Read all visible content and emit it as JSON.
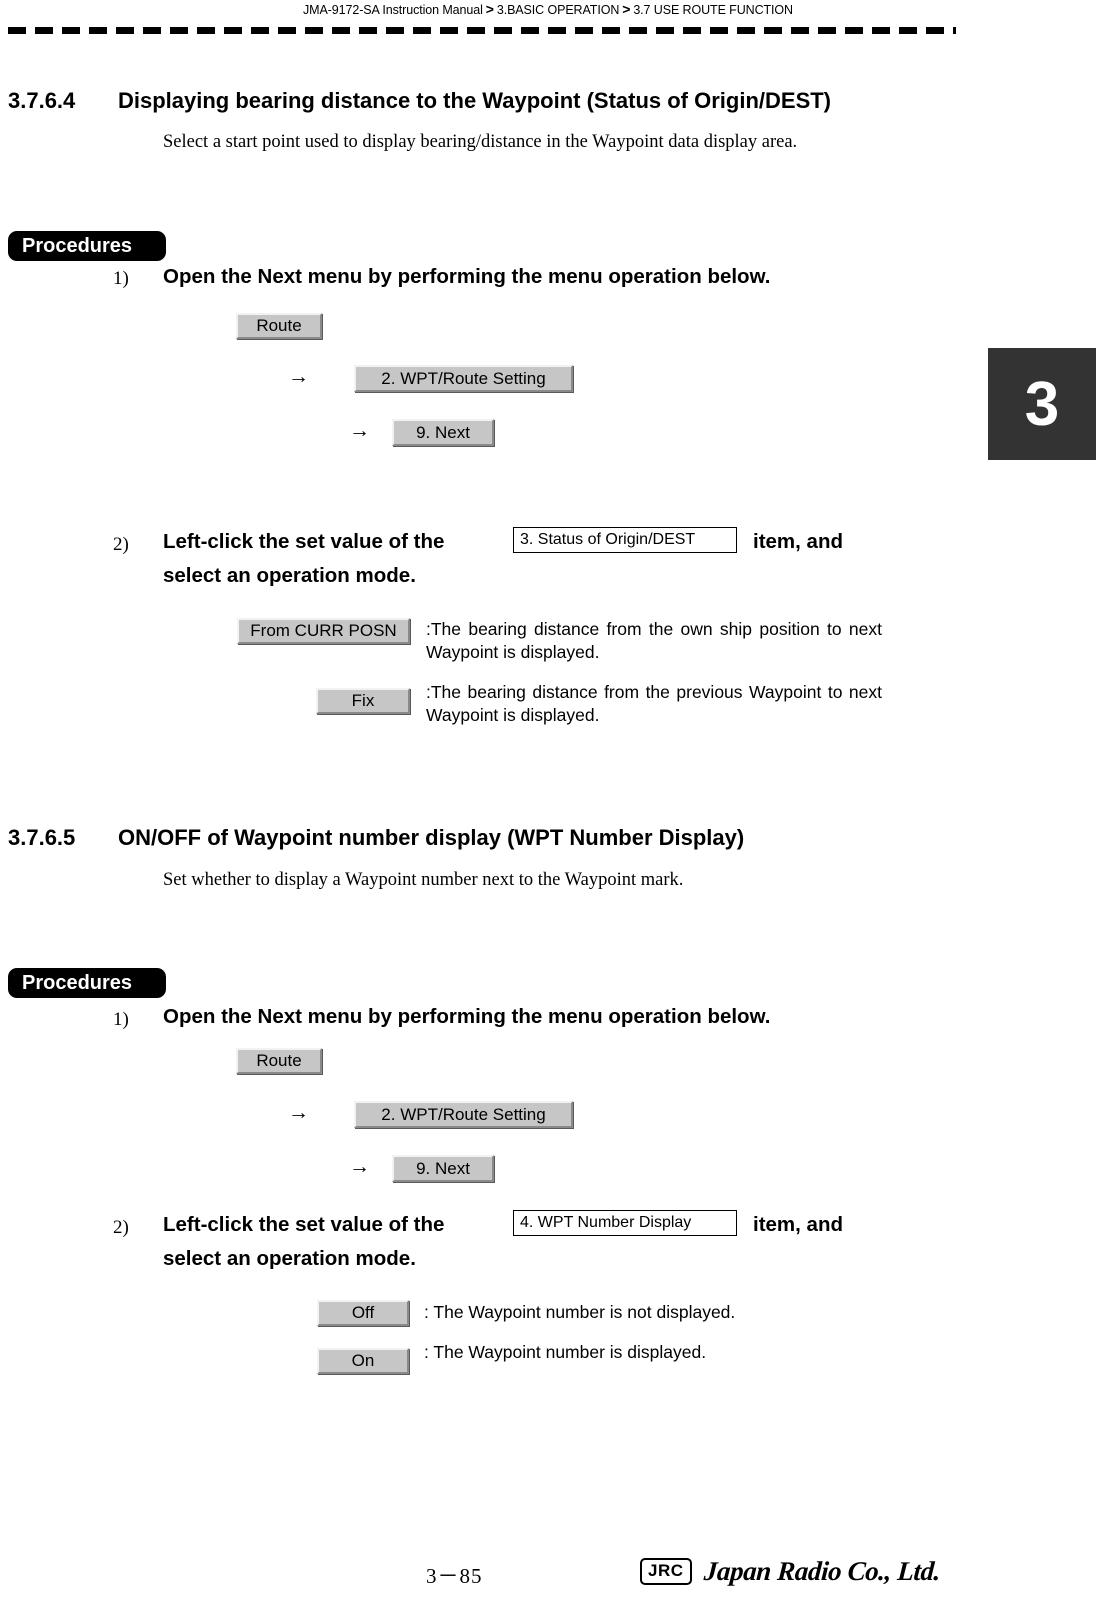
{
  "header": {
    "manual_title": "JMA-9172-SA Instruction Manual",
    "separator": ">",
    "crumb_chapter": "3.BASIC OPERATION",
    "crumb_section": "3.7  USE ROUTE FUNCTION"
  },
  "chapter_tab": {
    "number": "3"
  },
  "sections": [
    {
      "number": "3.7.6.4",
      "title": "Displaying bearing distance to the Waypoint (Status of Origin/DEST)",
      "description": "Select a start point used to display bearing/distance in the Waypoint data display area.",
      "procedures_label": "Procedures",
      "step1": {
        "num": "1)",
        "text": "Open the Next menu by performing the menu operation below.",
        "menu_path": [
          {
            "label": "Route"
          },
          {
            "label": "2. WPT/Route Setting"
          },
          {
            "label": "9. Next"
          }
        ],
        "arrow": "→"
      },
      "step2": {
        "num": "2)",
        "text_before": "Left-click the set value of the",
        "item_box": "3. Status of Origin/DEST",
        "text_after": "item, and",
        "text_line2": "select an operation mode.",
        "options": [
          {
            "button": "From CURR POSN",
            "description": ":The bearing distance from the own ship position to next Waypoint is displayed."
          },
          {
            "button": "Fix",
            "description": ":The bearing distance from the previous Waypoint to next Waypoint is displayed."
          }
        ]
      }
    },
    {
      "number": "3.7.6.5",
      "title": "ON/OFF of Waypoint number display (WPT Number Display)",
      "description": "Set whether to display a Waypoint number next to the Waypoint mark.",
      "procedures_label": "Procedures",
      "step1": {
        "num": "1)",
        "text": "Open the Next menu by performing the menu operation below.",
        "menu_path": [
          {
            "label": "Route"
          },
          {
            "label": "2. WPT/Route Setting"
          },
          {
            "label": "9. Next"
          }
        ],
        "arrow": "→"
      },
      "step2": {
        "num": "2)",
        "text_before": "Left-click the set value of the",
        "item_box": "4. WPT Number Display",
        "text_after": "item, and",
        "text_line2": "select an operation mode.",
        "options": [
          {
            "button": "Off",
            "description": ": The Waypoint number is not displayed."
          },
          {
            "button": "On",
            "description": ": The Waypoint number is displayed."
          }
        ]
      }
    }
  ],
  "footer": {
    "page_number": "3－85",
    "logo_mark": "JRC",
    "logo_name": "Japan Radio Co., Ltd."
  }
}
